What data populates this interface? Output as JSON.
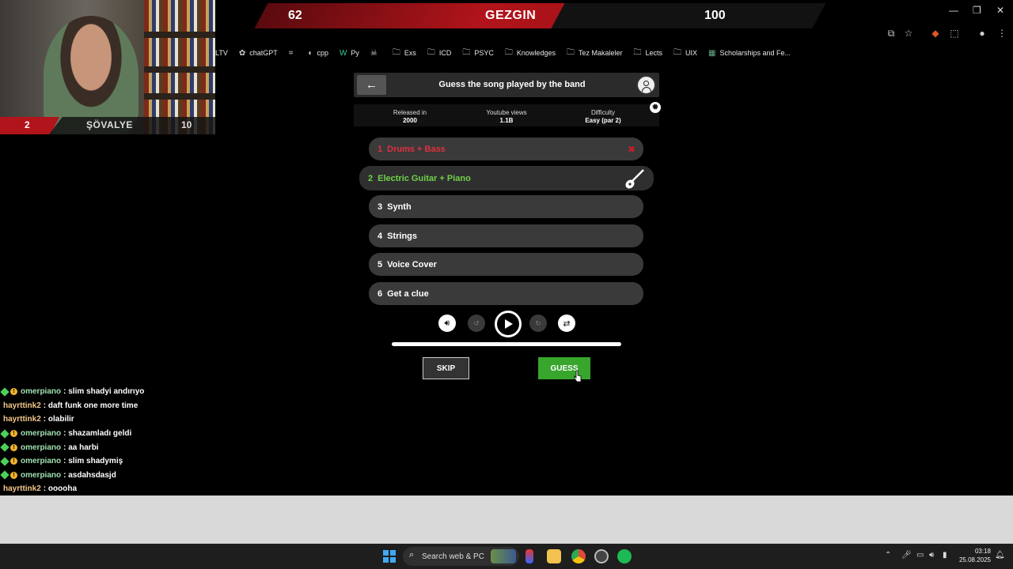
{
  "score_banner": {
    "left_score": "62",
    "title": "GEZGIN",
    "right_score": "100"
  },
  "webcam": {
    "left_score": "2",
    "name": "ŞÖVALYE",
    "right_score": "10"
  },
  "bookmarks": [
    {
      "label": "LTV",
      "icon": ""
    },
    {
      "label": "chatGPT",
      "icon": "chatgpt-icon"
    },
    {
      "label": "",
      "icon": "grid-icon"
    },
    {
      "label": "cpp",
      "icon": "cpp-icon"
    },
    {
      "label": "Py",
      "icon": "py-icon"
    },
    {
      "label": "",
      "icon": "skull-icon"
    },
    {
      "label": "Exs",
      "icon": "folder-icon"
    },
    {
      "label": "ICD",
      "icon": "folder-icon"
    },
    {
      "label": "PSYC",
      "icon": "folder-icon"
    },
    {
      "label": "Knowledges",
      "icon": "folder-icon"
    },
    {
      "label": "Tez Makaleler",
      "icon": "folder-icon"
    },
    {
      "label": "Lects",
      "icon": "folder-icon"
    },
    {
      "label": "UIX",
      "icon": "folder-icon"
    },
    {
      "label": "Scholarships and Fe...",
      "icon": "image-icon"
    }
  ],
  "game": {
    "title": "Guess the song played by the band",
    "stats": [
      {
        "label": "Released in",
        "value": "2000"
      },
      {
        "label": "Youtube views",
        "value": "1.1B"
      },
      {
        "label": "Difficulty",
        "value": "Easy (par 2)"
      }
    ],
    "tracks": [
      {
        "num": "1",
        "label": "Drums + Bass",
        "state": "failed"
      },
      {
        "num": "2",
        "label": "Electric Guitar + Piano",
        "state": "active"
      },
      {
        "num": "3",
        "label": "Synth",
        "state": "locked"
      },
      {
        "num": "4",
        "label": "Strings",
        "state": "locked"
      },
      {
        "num": "5",
        "label": "Voice Cover",
        "state": "locked"
      },
      {
        "num": "6",
        "label": "Get a clue",
        "state": "locked"
      }
    ],
    "progress": 1.0,
    "skip_label": "SKIP",
    "guess_label": "GUESS"
  },
  "chat": [
    {
      "user": "omerpiano",
      "msg": ": slim shadyi andırıyo",
      "badges": true
    },
    {
      "user": "hayrttink2",
      "msg": ": daft funk one more time",
      "badges": false
    },
    {
      "user": "hayrttink2",
      "msg": ": olabilir",
      "badges": false
    },
    {
      "user": "omerpiano",
      "msg": ": shazamladı geldi",
      "badges": true
    },
    {
      "user": "omerpiano",
      "msg": ": aa harbi",
      "badges": true
    },
    {
      "user": "omerpiano",
      "msg": ": slim shadymiş",
      "badges": true
    },
    {
      "user": "omerpiano",
      "msg": ": asdahsdasjd",
      "badges": true
    },
    {
      "user": "hayrttink2",
      "msg": ": ooooha",
      "badges": false
    }
  ],
  "taskbar": {
    "search_placeholder": "Search web & PC",
    "time": "03:18",
    "date": "25.08.2025"
  },
  "colors": {
    "accent_red": "#b1141a",
    "guess_green": "#38a52c",
    "active_track": "#6fd14a",
    "failed_track": "#e03040"
  }
}
